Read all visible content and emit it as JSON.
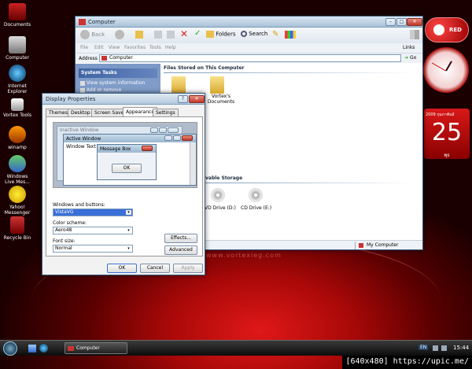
{
  "desktop": {
    "icons": [
      {
        "label": "Documents"
      },
      {
        "label": "Computer"
      },
      {
        "label": "Internet Explorer"
      },
      {
        "label": "Vortex Tools"
      },
      {
        "label": "winamp"
      },
      {
        "label": "Windows Live Mes..."
      },
      {
        "label": "Yahoo! Messenger"
      },
      {
        "label": "Recycle Bin"
      }
    ],
    "watermark_site": "www.vortexieg.com"
  },
  "explorer": {
    "title": "Computer",
    "toolbar": {
      "back": "Back",
      "folders": "Folders",
      "search": "Search"
    },
    "menu": [
      "File",
      "Edit",
      "View",
      "Favorites",
      "Tools",
      "Help"
    ],
    "links": "Links",
    "address_label": "Address",
    "address_value": "Computer",
    "go": "Go",
    "tasks_header": "System Tasks",
    "tasks": [
      "View system information",
      "Add or remove"
    ],
    "section_files": "Files Stored on This Computer",
    "folder_vortex": "Vortex's Documents",
    "section_storage": "vable Storage",
    "dvd_drive": "VD Drive (D:)",
    "cd_drive": "CD Drive (E:)",
    "status": "My Computer"
  },
  "display_props": {
    "title": "Display Properties",
    "help": "?",
    "tabs": [
      "Themes",
      "Desktop",
      "Screen Saver",
      "Appearance",
      "Settings"
    ],
    "preview": {
      "inactive": "Inactive Window",
      "active": "Active Window",
      "window_text": "Window Text",
      "message_box": "Message Box",
      "ok": "OK"
    },
    "windows_buttons_label": "Windows and buttons:",
    "windows_buttons_value": "VistaVG",
    "color_scheme_label": "Color scheme:",
    "color_scheme_value": "Aero48",
    "font_size_label": "Font size:",
    "font_size_value": "Normal",
    "effects": "Effects...",
    "advanced": "Advanced",
    "ok": "OK",
    "cancel": "Cancel",
    "apply": "Apply"
  },
  "gadgets": {
    "logo": "RED",
    "date_top": "2009 กุมภาพันธ์",
    "day": "25",
    "weekday": "พุธ"
  },
  "taskbar": {
    "task": "Computer",
    "lang": "EN",
    "time": "15:44"
  },
  "image_footer": "[640x480] https://upic.me/"
}
